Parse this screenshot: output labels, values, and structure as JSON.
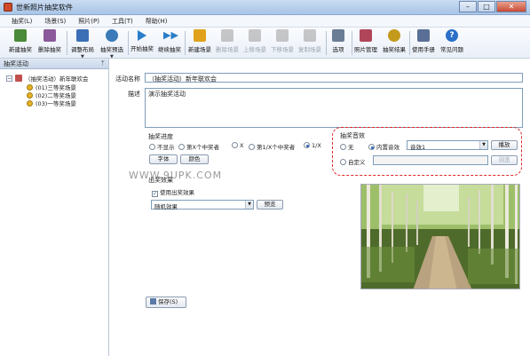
{
  "window": {
    "title": "世新照片抽奖软件"
  },
  "menu": [
    "抽奖(L)",
    "场景(S)",
    "照片(P)",
    "工具(T)",
    "帮助(H)"
  ],
  "toolbar": [
    {
      "label": "新建抽奖",
      "icon": "new-lottery-icon",
      "color": "#4a8a3a",
      "disabled": false
    },
    {
      "label": "删除抽奖",
      "icon": "delete-lottery-icon",
      "color": "#8a5a9a",
      "disabled": false
    },
    {
      "label": "调整布局",
      "icon": "layout-icon",
      "color": "#3a6fb5",
      "disabled": false,
      "dropdown": true
    },
    {
      "label": "抽奖预选",
      "icon": "preselect-icon",
      "color": "#3a7ab8",
      "disabled": false,
      "dropdown": true
    },
    {
      "label": "开始抽奖",
      "icon": "play-icon",
      "color": "#2a7dc8",
      "disabled": false
    },
    {
      "label": "继续抽奖",
      "icon": "fast-forward-icon",
      "color": "#2a7dc8",
      "disabled": false
    },
    {
      "label": "新建场景",
      "icon": "new-scene-icon",
      "color": "#e0a21c",
      "disabled": false
    },
    {
      "label": "删除场景",
      "icon": "delete-scene-icon",
      "color": "#888888",
      "disabled": true
    },
    {
      "label": "上移场景",
      "icon": "move-up-icon",
      "color": "#888888",
      "disabled": true
    },
    {
      "label": "下移场景",
      "icon": "move-down-icon",
      "color": "#888888",
      "disabled": true
    },
    {
      "label": "复制场景",
      "icon": "copy-scene-icon",
      "color": "#888888",
      "disabled": true
    },
    {
      "label": "选项",
      "icon": "wrench-icon",
      "color": "#6a7d94",
      "disabled": false
    },
    {
      "label": "照片管理",
      "icon": "photo-manage-icon",
      "color": "#b0455a",
      "disabled": false
    },
    {
      "label": "抽奖结果",
      "icon": "result-icon",
      "color": "#c49a1c",
      "disabled": false
    },
    {
      "label": "使用手册",
      "icon": "manual-icon",
      "color": "#5a6f95",
      "disabled": false
    },
    {
      "label": "常见问题",
      "icon": "help-icon",
      "color": "#2a6fc8",
      "disabled": false
    }
  ],
  "left_panel": {
    "title": "抽奖活动",
    "root": "（抽奖活动）新年联欢会",
    "children": [
      "(01)三等奖场景",
      "(02)二等奖场景",
      "(03)一等奖场景"
    ]
  },
  "form": {
    "name_label": "活动名称",
    "name_value": "（抽奖活动）新年联欢会",
    "desc_label": "描述",
    "desc_value": "演示抽奖活动",
    "progress_group": "抽奖进度",
    "progress_options": [
      "不显示",
      "第X个中奖者",
      "X",
      "第1/X个中奖者",
      "1/X"
    ],
    "progress_selected": 4,
    "font_button": "字体",
    "color_button": "颜色",
    "sound_group": "抽奖音效",
    "sound_none": "无",
    "sound_builtin": "内置音效",
    "sound_select": "音效1",
    "play_button": "播放",
    "sound_custom": "自定义",
    "browse_button": "浏览",
    "effect_group": "出奖效果",
    "use_effect_label": "使用出奖效果",
    "effect_select": "随机效果",
    "preview_button": "预览",
    "save_button": "保存(S)"
  },
  "watermark": "WWW.9UPK.COM"
}
